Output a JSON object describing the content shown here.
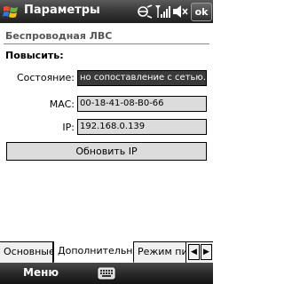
{
  "titlebar": {
    "title": "Параметры",
    "ok_label": "ok",
    "icons": [
      "windows-start-flag",
      "connectivity-icon",
      "signal-strength-icon",
      "volume-icon"
    ]
  },
  "header": {
    "title": "Беспроводная ЛВС"
  },
  "section": {
    "label": "Повысить:"
  },
  "rows": [
    {
      "label": "Состояние:",
      "value": "но сопоставление с сетью."
    },
    {
      "label": "MAC:",
      "value": "00-18-41-08-B0-66"
    },
    {
      "label": "IP:",
      "value": "192.168.0.139"
    }
  ],
  "renew_button": {
    "label": "Обновить IP"
  },
  "tabs": [
    {
      "label": "Основные",
      "active": false
    },
    {
      "label": "Дополнительно",
      "active": true
    },
    {
      "label": "Режим питания",
      "active": false
    }
  ],
  "tab_scroll": {
    "left": "◀",
    "right": "▶"
  },
  "softkeys": {
    "left_label": "Меню",
    "center_icon": "keyboard-icon"
  },
  "colors": {
    "titlebar": "#2e2e2e",
    "field_bg": "#dcdcdc",
    "selected_field_bg": "#3a3a3a"
  }
}
